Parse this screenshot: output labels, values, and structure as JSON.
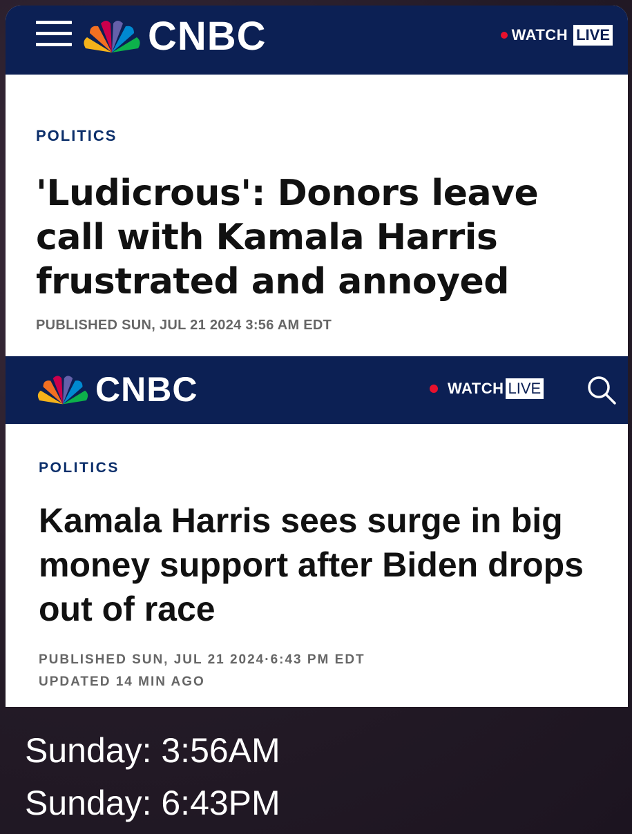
{
  "card1": {
    "logo_text": "CNBC",
    "watch_label": "WATCH",
    "live_label": "LIVE",
    "section": "POLITICS",
    "headline": "'Ludicrous': Donors leave call with Kamala Harris frustrated and annoyed",
    "published": "PUBLISHED SUN, JUL 21 2024 3:56 AM EDT"
  },
  "card2": {
    "logo_text": "CNBC",
    "watch_label": "WATCH",
    "live_label": "LIVE",
    "section": "POLITICS",
    "headline": "Kamala Harris sees surge in big money support after Biden drops out of race",
    "published": "PUBLISHED SUN, JUL 21 2024·6:43 PM EDT",
    "updated": "UPDATED 14 MIN AGO"
  },
  "captions": {
    "line1": "Sunday: 3:56AM",
    "line2": "Sunday: 6:43PM"
  },
  "colors": {
    "navy": "#0c2054",
    "live_dot": "#e8112d",
    "section_blue": "#0c2f6b"
  },
  "icons": [
    "hamburger-icon",
    "nbc-peacock-icon",
    "search-icon"
  ]
}
